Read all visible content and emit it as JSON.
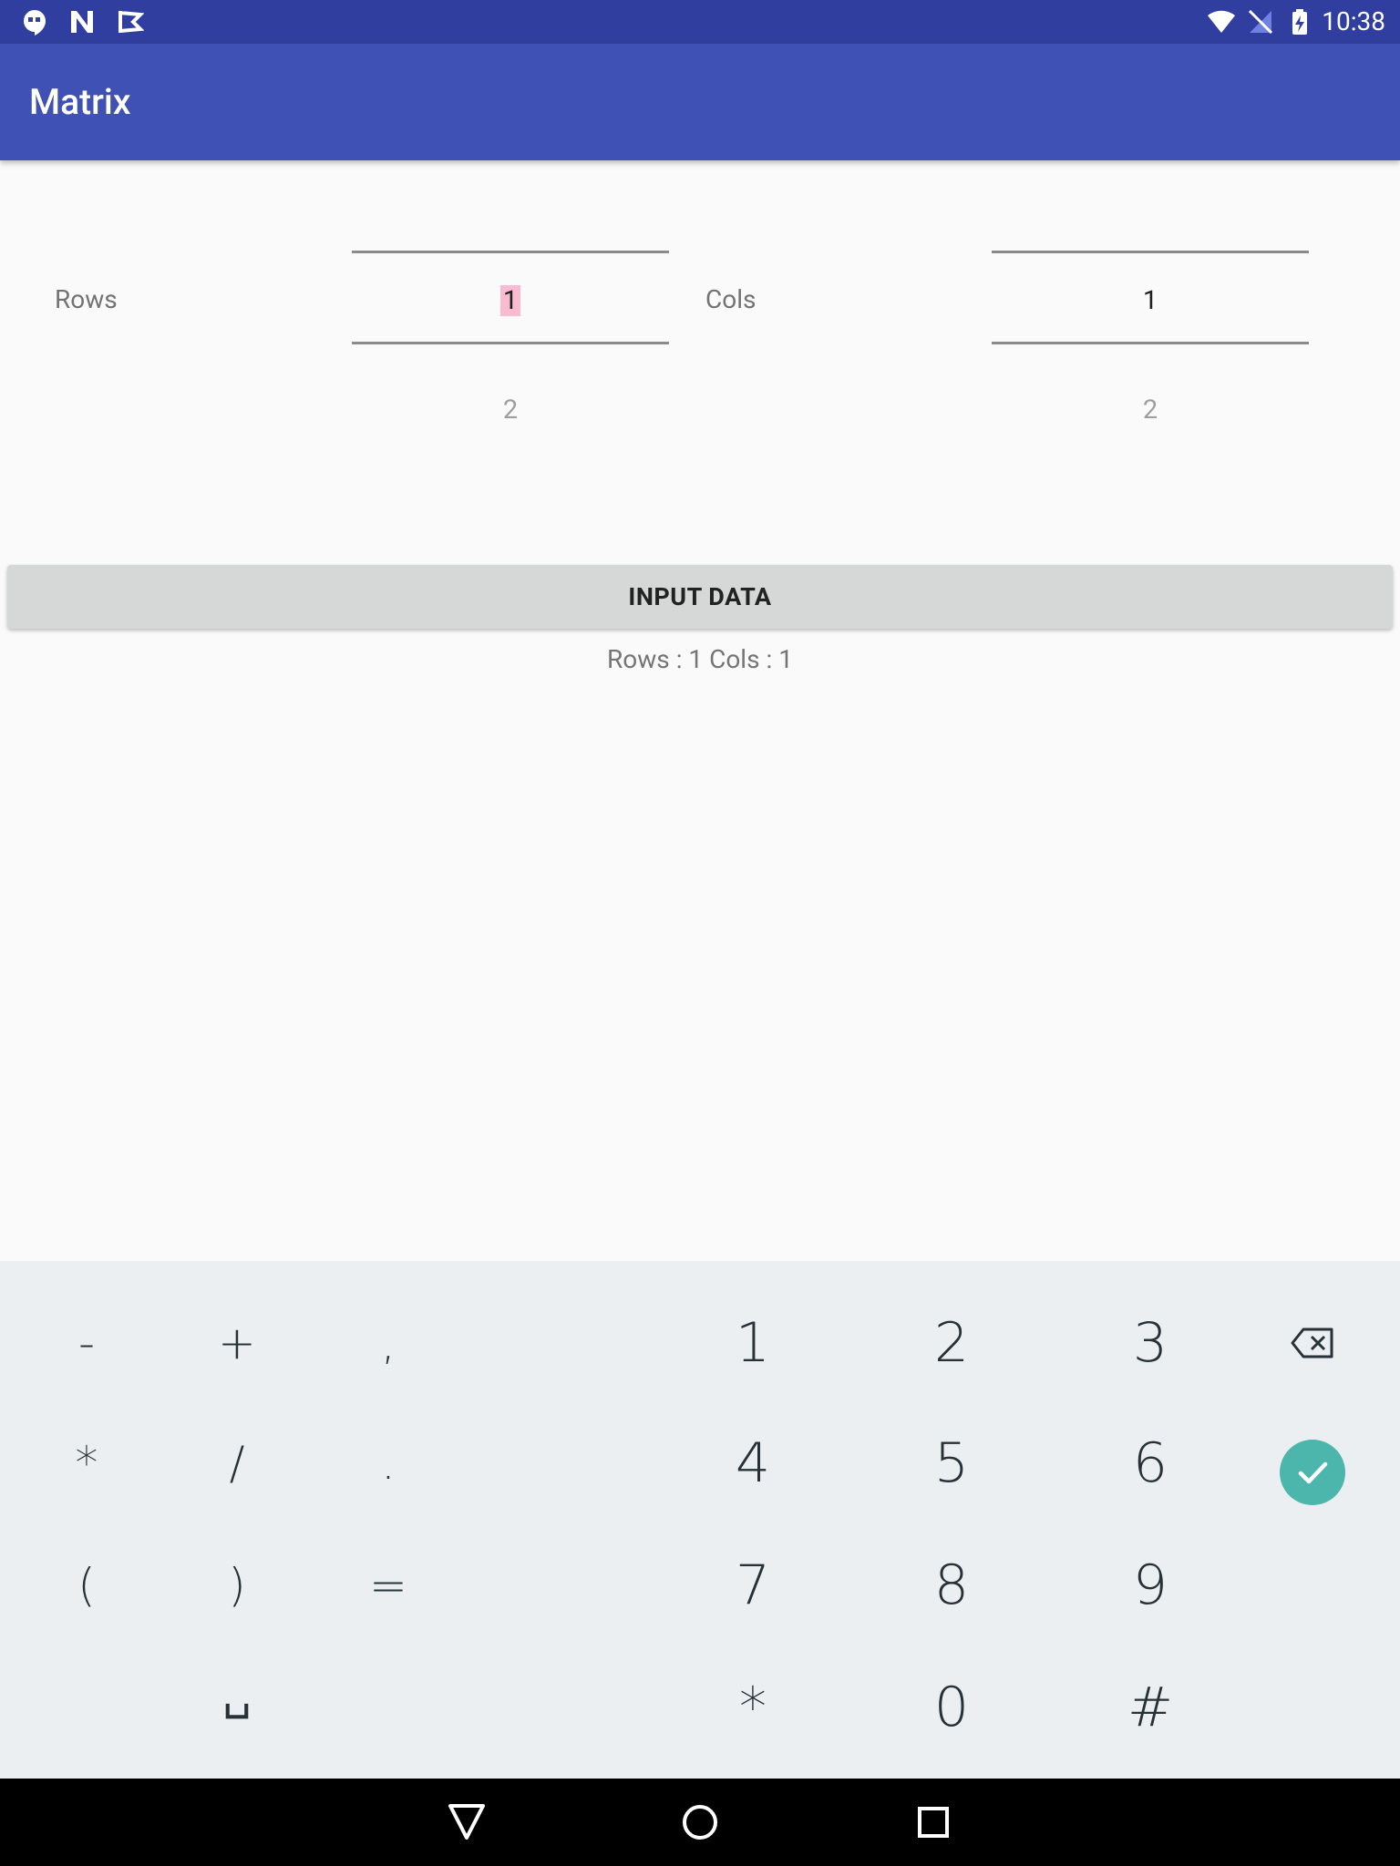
{
  "status_bar": {
    "time": "10:38",
    "left_icons": [
      "hangouts-icon",
      "n-icon",
      "check-flag-icon"
    ],
    "right_icons": [
      "wifi-icon",
      "no-signal-icon",
      "battery-charging-icon"
    ]
  },
  "app_bar": {
    "title": "Matrix"
  },
  "pickers": {
    "rows": {
      "label": "Rows",
      "selected": "1",
      "next": "2"
    },
    "cols": {
      "label": "Cols",
      "selected": "1",
      "next": "2"
    }
  },
  "actions": {
    "input_data_label": "INPUT DATA"
  },
  "result": {
    "text": "Rows : 1 Cols : 1"
  },
  "keyboard": {
    "symbols": [
      "-",
      "+",
      ",",
      "*",
      "/",
      ".",
      "(",
      ")",
      "=",
      "␣"
    ],
    "digits": [
      "1",
      "2",
      "3",
      "4",
      "5",
      "6",
      "7",
      "8",
      "9",
      "*",
      "0",
      "#"
    ],
    "accent": "#4db6ac"
  },
  "nav_bar": {
    "icons": [
      "back-icon",
      "home-icon",
      "recents-icon"
    ]
  },
  "colors": {
    "status_bar": "#303f9f",
    "app_bar": "#3f51b5",
    "keyboard_bg": "#eceff1"
  }
}
